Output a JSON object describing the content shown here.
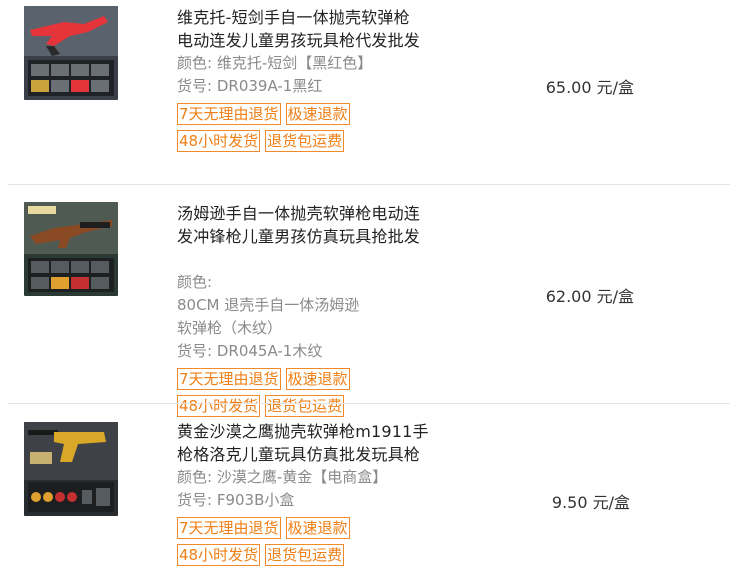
{
  "items": [
    {
      "title": "维克托-短剑手自一体抛壳软弹枪\n电动连发儿童男孩玩具枪代发批发",
      "color_label": "颜色:",
      "color_value": "维克托-短剑【黑红色】",
      "sku_label": "货号:",
      "sku_value": "DR039A-1黑红",
      "price": "65.00 元/盒",
      "thumb_icon": "red-toy-gun-product-image",
      "tags": [
        [
          "7天无理由退货",
          "极速退款"
        ],
        [
          "48小时发货",
          "退货包运费"
        ]
      ]
    },
    {
      "title": "汤姆逊手自一体抛壳软弹枪电动连\n发冲锋枪儿童男孩仿真玩具抢批发",
      "color_label": "颜色:",
      "color_value": "80CM 退壳手自一体汤姆逊\n软弹枪（木纹）",
      "sku_label": "货号:",
      "sku_value": "DR045A-1木纹",
      "price": "62.00 元/盒",
      "thumb_icon": "wood-toy-rifle-product-image",
      "tags": [
        [
          "7天无理由退货",
          "极速退款"
        ],
        [
          "48小时发货",
          "退货包运费"
        ]
      ]
    },
    {
      "title": "黄金沙漠之鹰抛壳软弹枪m1911手\n枪格洛克儿童玩具仿真批发玩具枪",
      "color_label": "颜色:",
      "color_value": "沙漠之鹰-黄金【电商盒】",
      "sku_label": "货号:",
      "sku_value": "F903B小盒",
      "price": "9.50 元/盒",
      "thumb_icon": "gold-toy-pistol-product-image",
      "tags": [
        [
          "7天无理由退货",
          "极速退款"
        ],
        [
          "48小时发货",
          "退货包运费"
        ]
      ]
    }
  ],
  "colors": {
    "tag_border": "#f08a2a",
    "tag_text": "#ef7f16",
    "meta": "#8a8a8a"
  }
}
